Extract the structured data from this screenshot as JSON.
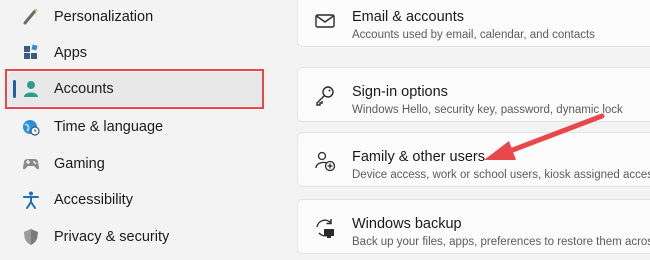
{
  "sidebar": {
    "items": [
      {
        "label": "Personalization",
        "icon": "brush-icon"
      },
      {
        "label": "Apps",
        "icon": "apps-icon"
      },
      {
        "label": "Accounts",
        "icon": "person-icon",
        "selected": true
      },
      {
        "label": "Time & language",
        "icon": "globe-clock-icon"
      },
      {
        "label": "Gaming",
        "icon": "gamepad-icon"
      },
      {
        "label": "Accessibility",
        "icon": "accessibility-icon"
      },
      {
        "label": "Privacy & security",
        "icon": "shield-icon"
      }
    ],
    "highlight_color": "#e8474b",
    "accent_color": "#1e5fa8"
  },
  "main": {
    "cards": [
      {
        "title": "Email & accounts",
        "description": "Accounts used by email, calendar, and contacts",
        "icon": "mail-icon"
      },
      {
        "title": "Sign-in options",
        "description": "Windows Hello, security key, password, dynamic lock",
        "icon": "key-icon"
      },
      {
        "title": "Family & other users",
        "description": "Device access, work or school users, kiosk assigned access",
        "icon": "family-add-icon"
      },
      {
        "title": "Windows backup",
        "description": "Back up your files, apps, preferences to restore them across",
        "icon": "backup-icon"
      }
    ]
  },
  "annotation": {
    "arrow_color": "#e8474b",
    "points_to": "Family & other users"
  }
}
